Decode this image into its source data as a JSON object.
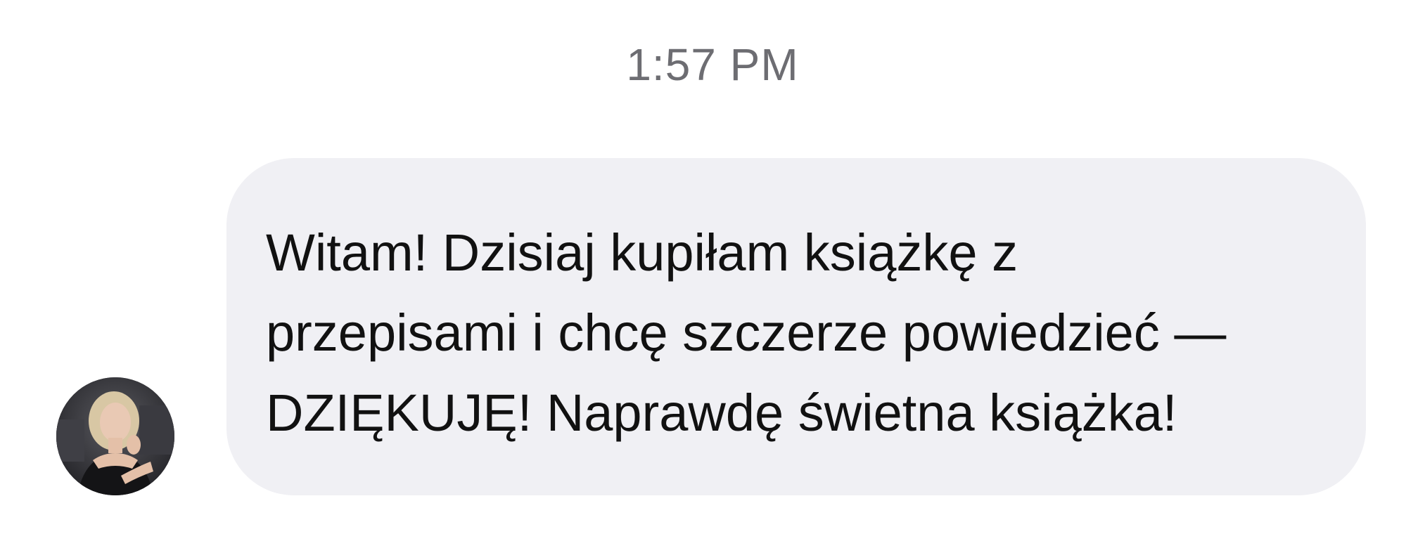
{
  "chat": {
    "timestamp": "1:57 PM",
    "message": {
      "sender_avatar_icon": "user-avatar-photo",
      "text": "Witam! Dzisiaj kupiłam książkę z\nprzepisami i chcę szczerze powiedzieć —\nDZIĘKUJĘ! Naprawdę świetna książka!"
    }
  },
  "colors": {
    "background": "#ffffff",
    "bubble": "#f0f0f4",
    "timestamp_text": "#6d6d72",
    "message_text": "#111111"
  }
}
